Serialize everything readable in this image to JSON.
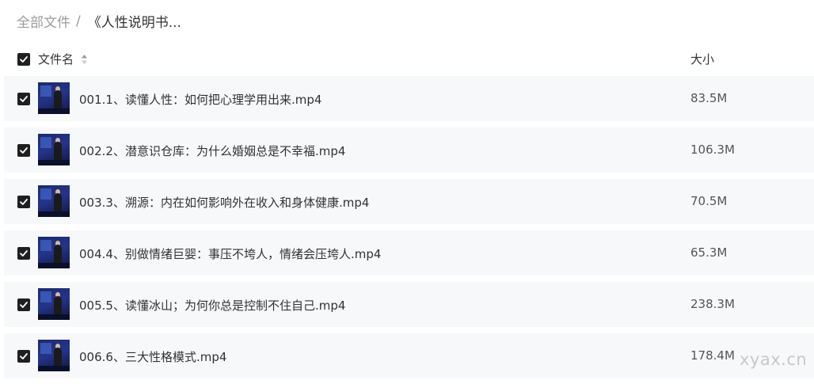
{
  "breadcrumb": {
    "root": "全部文件",
    "separator": "/",
    "current": "《人性说明书..."
  },
  "table": {
    "columns": {
      "name": "文件名",
      "size": "大小"
    },
    "header_checked": true,
    "rows": [
      {
        "name": "001.1、读懂人性：如何把心理学用出来.mp4",
        "size": "83.5M",
        "checked": true
      },
      {
        "name": "002.2、潜意识仓库：为什么婚姻总是不幸福.mp4",
        "size": "106.3M",
        "checked": true
      },
      {
        "name": "003.3、溯源：内在如何影响外在收入和身体健康.mp4",
        "size": "70.5M",
        "checked": true
      },
      {
        "name": "004.4、别做情绪巨婴：事压不垮人，情绪会压垮人.mp4",
        "size": "65.3M",
        "checked": true
      },
      {
        "name": "005.5、读懂冰山；为何你总是控制不住自己.mp4",
        "size": "238.3M",
        "checked": true
      },
      {
        "name": "006.6、三大性格模式.mp4",
        "size": "178.4M",
        "checked": true
      }
    ]
  },
  "watermark": "xyax.cn",
  "colors": {
    "checkbox": "#1f1f1f",
    "row_bg": "#f7f8fa",
    "muted_text": "#9b9b9b"
  }
}
